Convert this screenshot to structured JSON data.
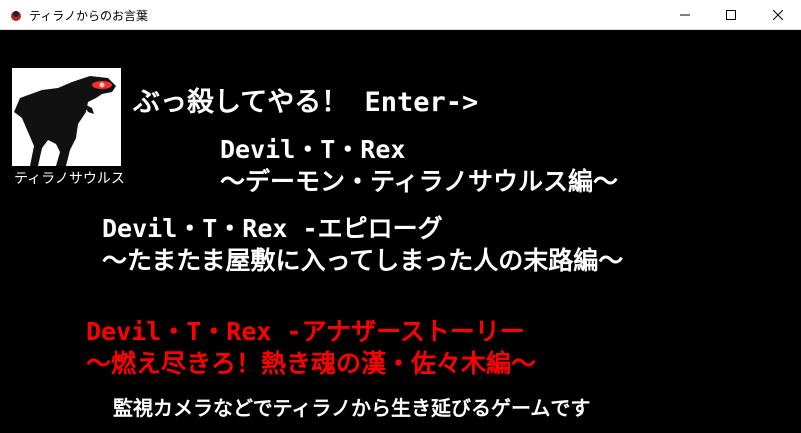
{
  "window": {
    "title": "ティラノからのお言葉"
  },
  "portrait": {
    "label": "ティラノサウルス",
    "icon": "trex-silhouette-red-eye-icon"
  },
  "prompt": "ぶっ殺してやる！ Enter->",
  "menu": [
    {
      "line1": "Devil・T・Rex",
      "line2": "～デーモン・ティラノサウルス編～"
    },
    {
      "line1": "Devil・T・Rex -エピローグ",
      "line2": "～たまたま屋敷に入ってしまった人の末路編～"
    },
    {
      "line1": "Devil・T・Rex -アナザーストーリー",
      "line2": "～燃え尽きろ！熱き魂の漢・佐々木編～"
    }
  ],
  "footer": "監視カメラなどでティラノから生き延びるゲームです",
  "colors": {
    "background": "#000000",
    "text": "#ffffff",
    "highlight": "#ff0000"
  }
}
